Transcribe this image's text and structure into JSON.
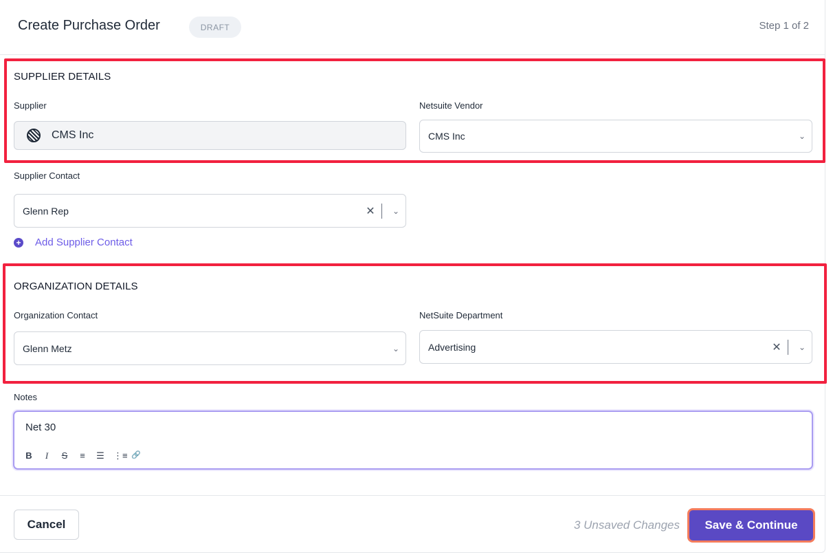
{
  "header": {
    "title": "Create Purchase Order",
    "badge": "DRAFT",
    "step": "Step 1 of 2"
  },
  "supplier_details": {
    "section_title": "SUPPLIER DETAILS",
    "supplier_label": "Supplier",
    "supplier_value": "CMS Inc",
    "vendor_label": "Netsuite Vendor",
    "vendor_value": "CMS Inc"
  },
  "supplier_contact": {
    "label": "Supplier Contact",
    "value": "Glenn Rep",
    "add_link": "Add Supplier Contact"
  },
  "organization_details": {
    "section_title": "ORGANIZATION DETAILS",
    "contact_label": "Organization Contact",
    "contact_value": "Glenn Metz",
    "department_label": "NetSuite Department",
    "department_value": "Advertising"
  },
  "notes": {
    "label": "Notes",
    "value": "Net 30",
    "toolbar": [
      "B",
      "I",
      "S",
      "≡",
      "☰",
      "⋮≡",
      "🔗"
    ]
  },
  "footer": {
    "cancel_label": "Cancel",
    "unsaved_text": "3 Unsaved Changes",
    "save_label": "Save & Continue"
  },
  "colors": {
    "accent": "#5a49c4",
    "highlight": "#f2213f",
    "save_outline": "#f47c5c"
  }
}
